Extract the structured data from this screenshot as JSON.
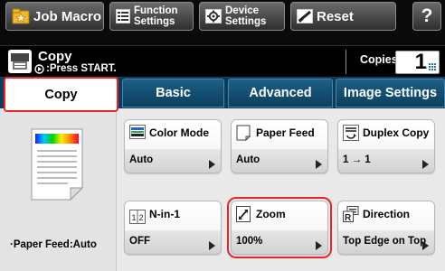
{
  "toolbar": {
    "job_macro": "Job Macro",
    "function_settings": "Function\nSettings",
    "device_settings": "Device\nSettings",
    "reset": "Reset",
    "help": "?"
  },
  "status": {
    "title": "Copy",
    "subtitle": ":Press START.",
    "copies_label": "Copies:",
    "copies_value": "1"
  },
  "tabs": [
    {
      "label": "Copy",
      "active": true
    },
    {
      "label": "Basic",
      "active": false
    },
    {
      "label": "Advanced",
      "active": false
    },
    {
      "label": "Image Settings",
      "active": false
    }
  ],
  "left_panel": {
    "paper_feed": "·Paper Feed:Auto"
  },
  "tiles": [
    {
      "title": "Color Mode",
      "value": "Auto",
      "icon": "color-mode-icon"
    },
    {
      "title": "Paper Feed",
      "value": "Auto",
      "icon": "paper-feed-icon"
    },
    {
      "title": "Duplex Copy",
      "value": "1 → 1",
      "icon": "duplex-copy-icon"
    },
    {
      "title": "N-in-1",
      "value": "OFF",
      "icon": "n-in-1-icon"
    },
    {
      "title": "Zoom",
      "value": "100%",
      "icon": "zoom-icon",
      "selected": true
    },
    {
      "title": "Direction",
      "value": "Top Edge on Top",
      "icon": "direction-icon"
    }
  ],
  "colors": {
    "highlight": "#e8242e",
    "tab_bar": "#0c3e5c",
    "toolbar": "#0a0a0a"
  }
}
